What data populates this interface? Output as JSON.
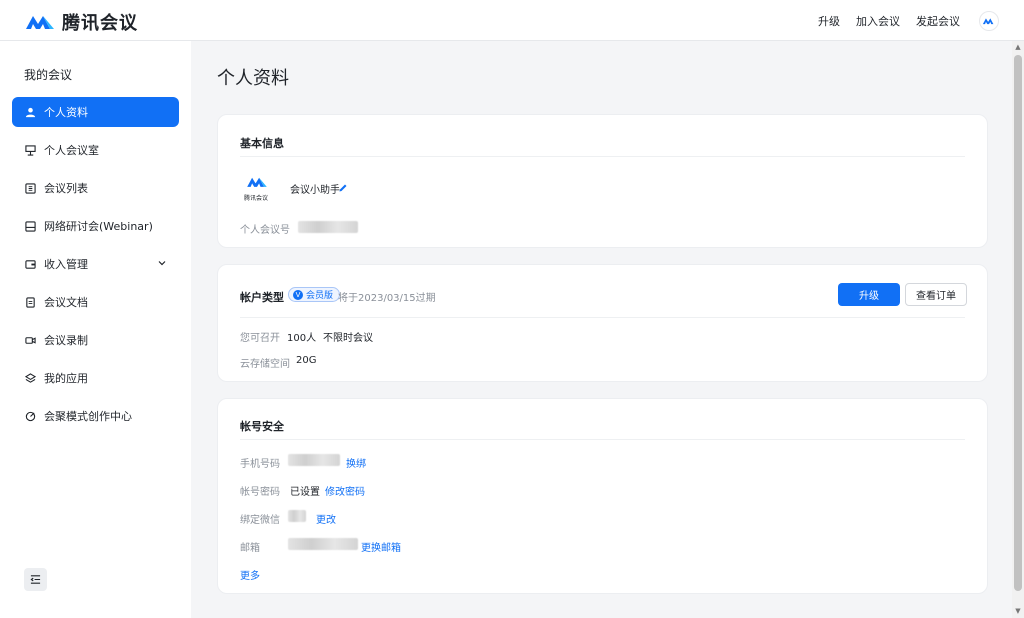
{
  "app": {
    "name": "腾讯会议"
  },
  "top_nav": {
    "upgrade": "升级",
    "join": "加入会议",
    "start": "发起会议"
  },
  "sidebar": {
    "title": "我的会议",
    "items": [
      {
        "label": "个人资料",
        "icon": "person-icon",
        "active": true
      },
      {
        "label": "个人会议室",
        "icon": "meeting-room-icon"
      },
      {
        "label": "会议列表",
        "icon": "list-icon"
      },
      {
        "label": "网络研讨会(Webinar)",
        "icon": "webinar-icon"
      },
      {
        "label": "收入管理",
        "icon": "wallet-icon",
        "expandable": true
      },
      {
        "label": "会议文档",
        "icon": "document-icon"
      },
      {
        "label": "会议录制",
        "icon": "recording-icon"
      },
      {
        "label": "我的应用",
        "icon": "apps-icon"
      },
      {
        "label": "会聚模式创作中心",
        "icon": "creation-center-icon"
      }
    ]
  },
  "page": {
    "title": "个人资料"
  },
  "basic_info": {
    "heading": "基本信息",
    "avatar_text": "腾讯会议",
    "nickname": "会议小助手",
    "meeting_id_label": "个人会议号"
  },
  "account_type": {
    "heading": "帐户类型",
    "badge": "会员版",
    "badge_icon": "V",
    "expiry": "将于2023/03/15过期",
    "upgrade_button": "升级",
    "orders_button": "查看订单",
    "capacity_label": "您可召开",
    "capacity_value": "100人",
    "duration_value": "不限时会议",
    "storage_label": "云存储空间",
    "storage_value": "20G"
  },
  "security": {
    "heading": "帐号安全",
    "phone_label": "手机号码",
    "phone_action": "换绑",
    "password_label": "帐号密码",
    "password_status": "已设置",
    "password_action": "修改密码",
    "wechat_label": "绑定微信",
    "wechat_action": "更改",
    "email_label": "邮箱",
    "email_action": "更换邮箱",
    "more": "更多"
  },
  "colors": {
    "accent": "#1170f5",
    "bg": "#f4f5f7",
    "muted": "#8a9099"
  }
}
